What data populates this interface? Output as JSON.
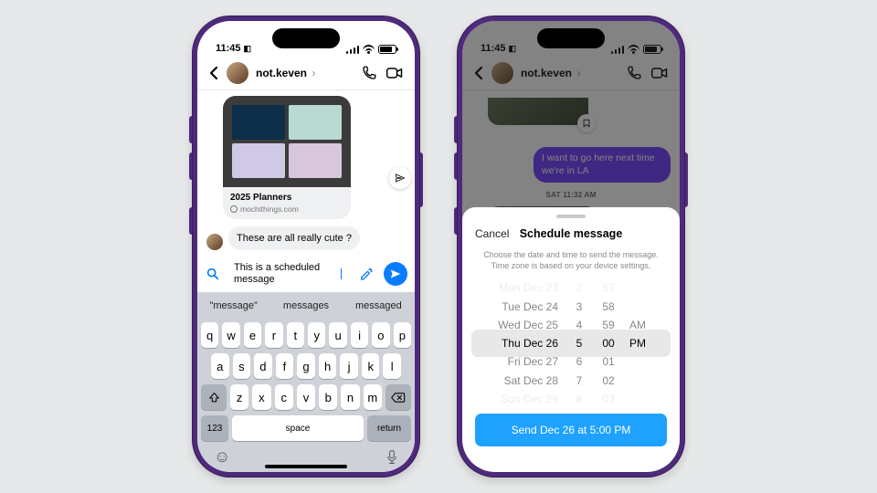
{
  "status": {
    "time": "11:45",
    "arrow": "↹"
  },
  "header": {
    "username": "not.keven"
  },
  "card": {
    "title": "2025 Planners",
    "domain": "mochithings.com"
  },
  "incoming_message": "These are all really cute ?",
  "composer": {
    "draft": "This is a scheduled message"
  },
  "suggestions": [
    "\"message\"",
    "messages",
    "messaged"
  ],
  "keyboard": {
    "row1": [
      "q",
      "w",
      "e",
      "r",
      "t",
      "y",
      "u",
      "i",
      "o",
      "p"
    ],
    "row2": [
      "a",
      "s",
      "d",
      "f",
      "g",
      "h",
      "j",
      "k",
      "l"
    ],
    "row3": [
      "z",
      "x",
      "c",
      "v",
      "b",
      "n",
      "m"
    ],
    "num": "123",
    "space": "space",
    "return": "return"
  },
  "p2": {
    "sent_message": "I want to go here next time we're in LA",
    "day_stamp": "SAT 11:32 AM"
  },
  "sheet": {
    "cancel": "Cancel",
    "title": "Schedule message",
    "subtitle": "Choose the date and time to send the message. Time zone is based on your device settings.",
    "picker": {
      "dates": [
        "Mon Dec 23",
        "Tue Dec 24",
        "Wed Dec 25",
        "Thu Dec 26",
        "Fri Dec 27",
        "Sat Dec 28",
        "Sun Dec 29"
      ],
      "hours": [
        "2",
        "3",
        "4",
        "5",
        "6",
        "7",
        "8"
      ],
      "mins": [
        "57",
        "58",
        "59",
        "00",
        "01",
        "02",
        "03"
      ],
      "ampm": [
        "",
        "",
        "AM",
        "PM",
        "",
        "",
        ""
      ]
    },
    "button": "Send Dec 26 at 5:00 PM"
  }
}
